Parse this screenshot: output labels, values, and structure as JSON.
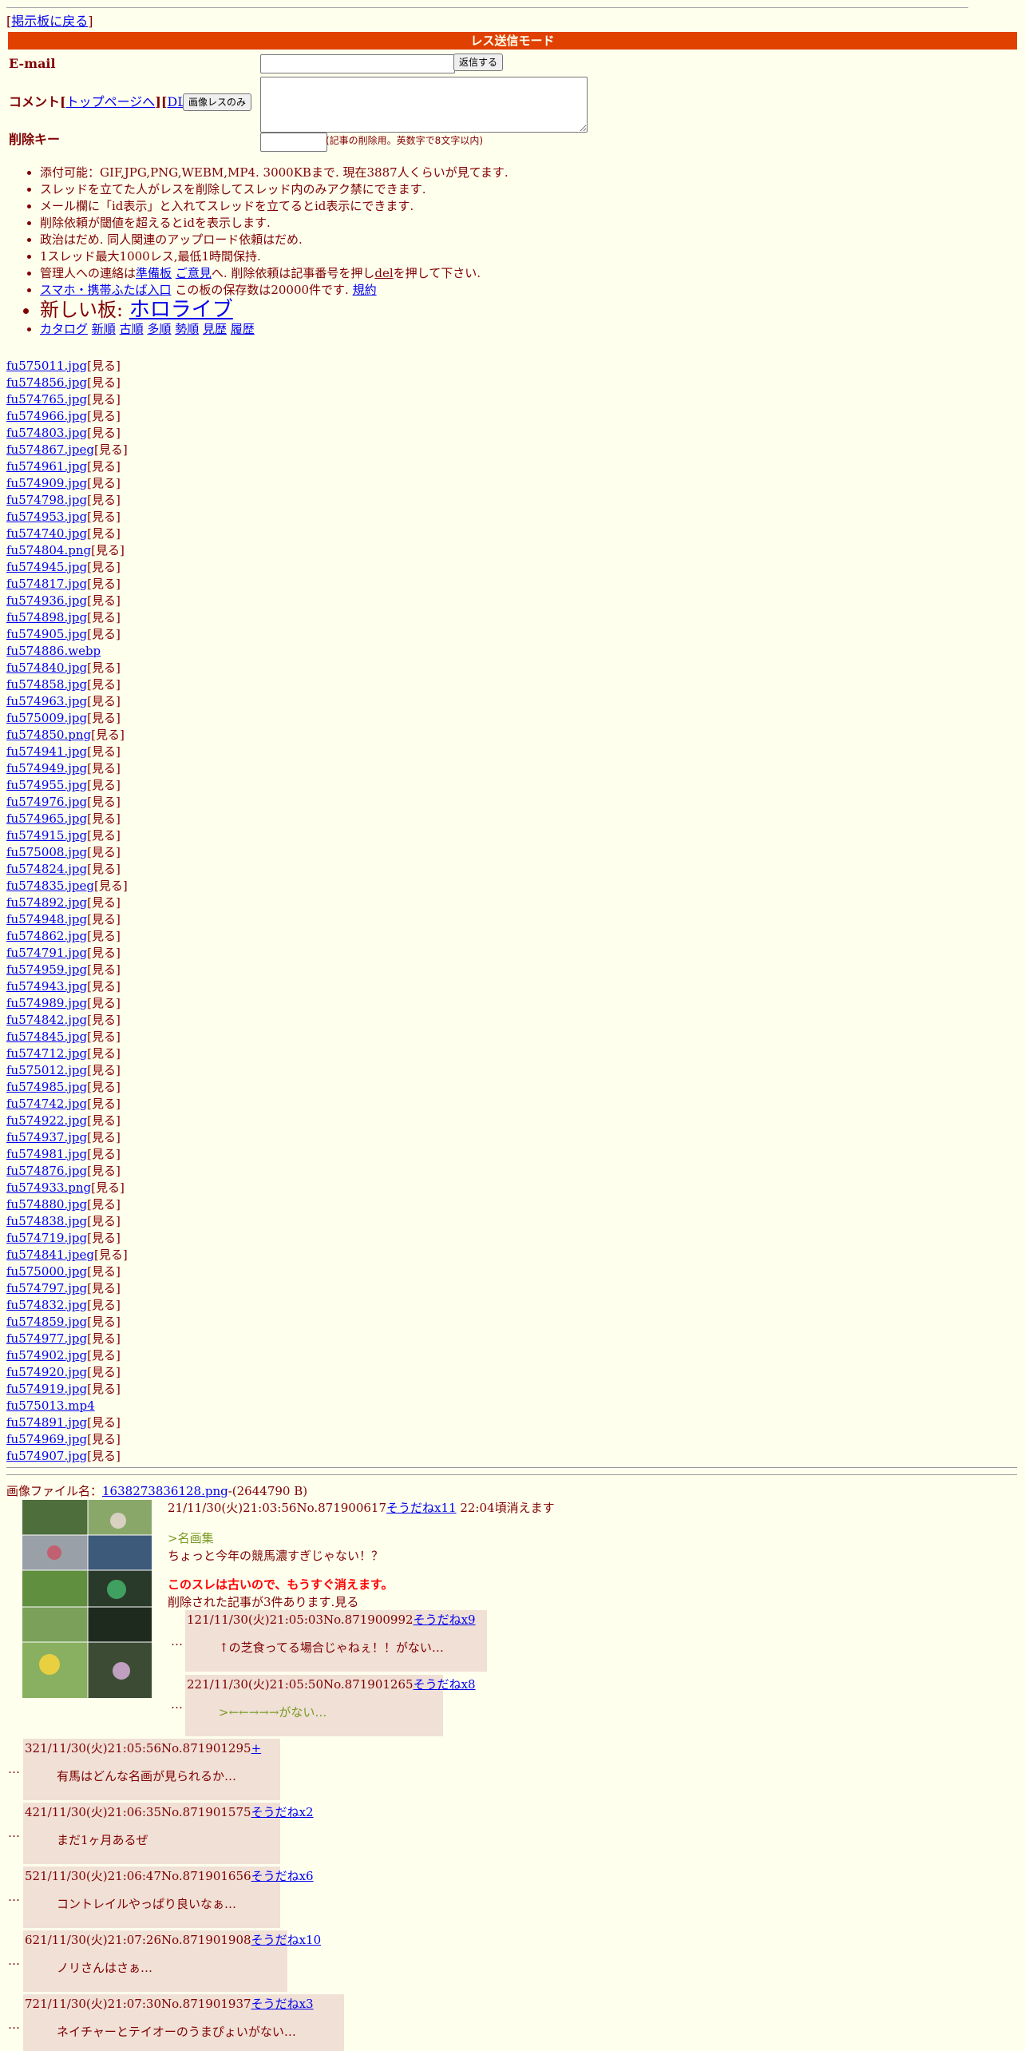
{
  "header": {
    "back_link": "掲示板に戻る",
    "mode_title": "レス送信モード"
  },
  "form": {
    "email_label": "E-mail",
    "send_button": "返信する",
    "comment_label": "コメント",
    "top_link": "トップページへ",
    "dl_link": "DL",
    "image_only_button": "画像レスのみ",
    "delete_key_label": "削除キー",
    "delete_key_note": "(記事の削除用。英数字で8文字以内)"
  },
  "rules": [
    "添付可能：GIF,JPG,PNG,WEBM,MP4. 3000KBまで. 現在3887人くらいが見てます.",
    "スレッドを立てた人がレスを削除してスレッド内のみアク禁にできます.",
    "メール欄に「id表示」と入れてスレッドを立てるとid表示にできます.",
    "削除依頼が閾値を超えるとidを表示します.",
    "政治はだめ. 同人関連のアップロード依頼はだめ.",
    "1スレッド最大1000レス,最低1時間保持."
  ],
  "rule_admin": {
    "prefix": "管理人への連絡は",
    "link1": "準備板",
    "link2": "ご意見",
    "middle": "へ. 削除依頼は記事番号を押し",
    "del": "del",
    "suffix": "を押して下さい."
  },
  "rule_mobile": {
    "link": "スマホ・携帯ふたば入口",
    "text": "この板の保存数は20000件です.",
    "link2": "規約"
  },
  "new_board": {
    "prefix": "新しい板:",
    "link": "ホロライブ"
  },
  "sort_links": [
    "カタログ",
    "新順",
    "古順",
    "多順",
    "勢順",
    "見歴",
    "履歴"
  ],
  "see_label": "[見る]",
  "files": [
    {
      "name": "fu575011.jpg",
      "see": true
    },
    {
      "name": "fu574856.jpg",
      "see": true
    },
    {
      "name": "fu574765.jpg",
      "see": true
    },
    {
      "name": "fu574966.jpg",
      "see": true
    },
    {
      "name": "fu574803.jpg",
      "see": true
    },
    {
      "name": "fu574867.jpeg",
      "see": true
    },
    {
      "name": "fu574961.jpg",
      "see": true
    },
    {
      "name": "fu574909.jpg",
      "see": true
    },
    {
      "name": "fu574798.jpg",
      "see": true
    },
    {
      "name": "fu574953.jpg",
      "see": true
    },
    {
      "name": "fu574740.jpg",
      "see": true
    },
    {
      "name": "fu574804.png",
      "see": true
    },
    {
      "name": "fu574945.jpg",
      "see": true
    },
    {
      "name": "fu574817.jpg",
      "see": true
    },
    {
      "name": "fu574936.jpg",
      "see": true
    },
    {
      "name": "fu574898.jpg",
      "see": true
    },
    {
      "name": "fu574905.jpg",
      "see": true
    },
    {
      "name": "fu574886.webp",
      "see": false
    },
    {
      "name": "fu574840.jpg",
      "see": true
    },
    {
      "name": "fu574858.jpg",
      "see": true
    },
    {
      "name": "fu574963.jpg",
      "see": true
    },
    {
      "name": "fu575009.jpg",
      "see": true
    },
    {
      "name": "fu574850.png",
      "see": true
    },
    {
      "name": "fu574941.jpg",
      "see": true
    },
    {
      "name": "fu574949.jpg",
      "see": true
    },
    {
      "name": "fu574955.jpg",
      "see": true
    },
    {
      "name": "fu574976.jpg",
      "see": true
    },
    {
      "name": "fu574965.jpg",
      "see": true
    },
    {
      "name": "fu574915.jpg",
      "see": true
    },
    {
      "name": "fu575008.jpg",
      "see": true
    },
    {
      "name": "fu574824.jpg",
      "see": true
    },
    {
      "name": "fu574835.jpeg",
      "see": true
    },
    {
      "name": "fu574892.jpg",
      "see": true
    },
    {
      "name": "fu574948.jpg",
      "see": true
    },
    {
      "name": "fu574862.jpg",
      "see": true
    },
    {
      "name": "fu574791.jpg",
      "see": true
    },
    {
      "name": "fu574959.jpg",
      "see": true
    },
    {
      "name": "fu574943.jpg",
      "see": true
    },
    {
      "name": "fu574989.jpg",
      "see": true
    },
    {
      "name": "fu574842.jpg",
      "see": true
    },
    {
      "name": "fu574845.jpg",
      "see": true
    },
    {
      "name": "fu574712.jpg",
      "see": true
    },
    {
      "name": "fu575012.jpg",
      "see": true
    },
    {
      "name": "fu574985.jpg",
      "see": true
    },
    {
      "name": "fu574742.jpg",
      "see": true
    },
    {
      "name": "fu574922.jpg",
      "see": true
    },
    {
      "name": "fu574937.jpg",
      "see": true
    },
    {
      "name": "fu574981.jpg",
      "see": true
    },
    {
      "name": "fu574876.jpg",
      "see": true
    },
    {
      "name": "fu574933.png",
      "see": true
    },
    {
      "name": "fu574880.jpg",
      "see": true
    },
    {
      "name": "fu574838.jpg",
      "see": true
    },
    {
      "name": "fu574719.jpg",
      "see": true
    },
    {
      "name": "fu574841.jpeg",
      "see": true
    },
    {
      "name": "fu575000.jpg",
      "see": true
    },
    {
      "name": "fu574797.jpg",
      "see": true
    },
    {
      "name": "fu574832.jpg",
      "see": true
    },
    {
      "name": "fu574859.jpg",
      "see": true
    },
    {
      "name": "fu574977.jpg",
      "see": true
    },
    {
      "name": "fu574902.jpg",
      "see": true
    },
    {
      "name": "fu574920.jpg",
      "see": true
    },
    {
      "name": "fu574919.jpg",
      "see": true
    },
    {
      "name": "fu575013.mp4",
      "see": false
    },
    {
      "name": "fu574891.jpg",
      "see": true
    },
    {
      "name": "fu574969.jpg",
      "see": true
    },
    {
      "name": "fu574907.jpg",
      "see": true
    }
  ],
  "thread": {
    "image_label": "画像ファイル名：",
    "image_name": "1638273836128.png",
    "image_size": "-(2644790 B)",
    "op_date": "21/11/30(火)21:03:56",
    "op_no": "No.871900617",
    "op_sodane": "そうだねx11",
    "op_expire": "22:04頃消えます",
    "op_quote": ">名画集",
    "op_text": "ちょっと今年の競馬濃すぎじゃない！？",
    "op_warning": "このスレは古いので、もうすぐ消えます。",
    "op_deleted": "削除された記事が3件あります.見る"
  },
  "replies": [
    {
      "num": "1",
      "date": "21/11/30(火)21:05:03",
      "no": "No.871900992",
      "sodane": "そうだねx9",
      "text": "↑の芝食ってる場合じゃねぇ！！がない…",
      "quote": false
    },
    {
      "num": "2",
      "date": "21/11/30(火)21:05:50",
      "no": "No.871901265",
      "sodane": "そうだねx8",
      "text": ">←←→→→がない…",
      "quote": true
    },
    {
      "num": "3",
      "date": "21/11/30(火)21:05:56",
      "no": "No.871901295",
      "sodane": "+",
      "text": "有馬はどんな名画が見られるか…",
      "quote": false
    },
    {
      "num": "4",
      "date": "21/11/30(火)21:06:35",
      "no": "No.871901575",
      "sodane": "そうだねx2",
      "text": "まだ1ヶ月あるぜ",
      "quote": false
    },
    {
      "num": "5",
      "date": "21/11/30(火)21:06:47",
      "no": "No.871901656",
      "sodane": "そうだねx6",
      "text": "コントレイルやっぱり良いなぁ…",
      "quote": false
    },
    {
      "num": "6",
      "date": "21/11/30(火)21:07:26",
      "no": "No.871901908",
      "sodane": "そうだねx10",
      "text": "ノリさんはさぁ…",
      "quote": false
    },
    {
      "num": "7",
      "date": "21/11/30(火)21:07:30",
      "no": "No.871901937",
      "sodane": "そうだねx3",
      "text": "ネイチャーとテイオーのうまぴょいがない…",
      "quote": false
    }
  ],
  "colors": {
    "background": "#ffffee",
    "text": "#800000",
    "header_bar": "#e04000",
    "reply_bg": "#f0e0d6",
    "quote": "#789922",
    "warning": "#ff0000",
    "link": "#0000ee"
  }
}
